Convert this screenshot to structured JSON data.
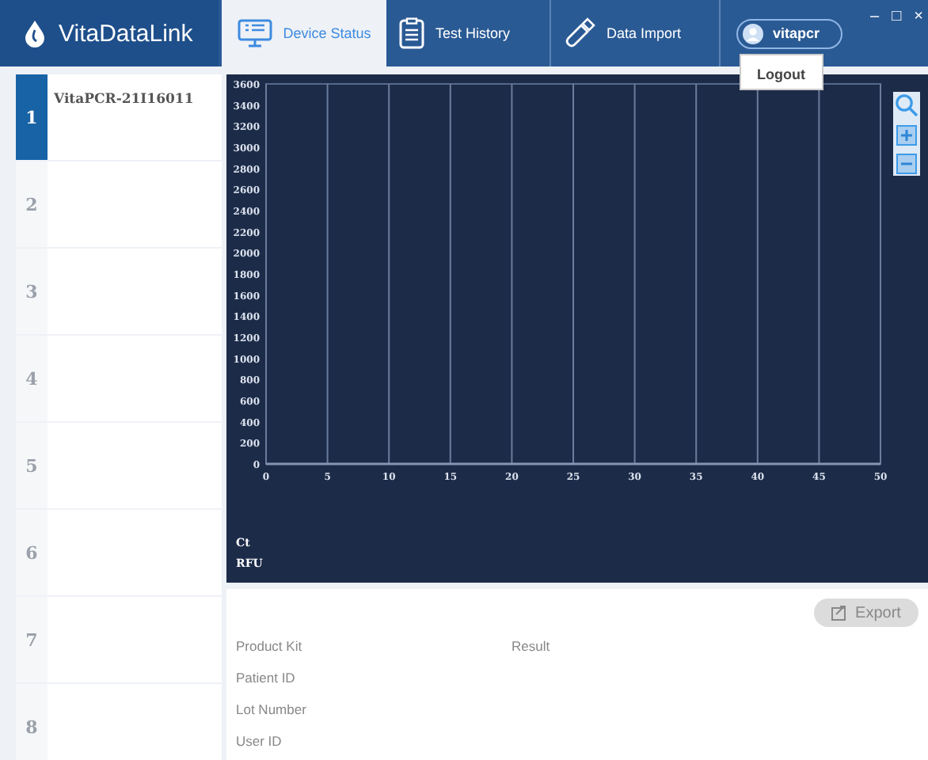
{
  "app": {
    "name": "VitaDataLink"
  },
  "tabs": [
    {
      "label": "Device Status",
      "selected": true
    },
    {
      "label": "Test History",
      "selected": false
    },
    {
      "label": "Data Import",
      "selected": false
    }
  ],
  "user": {
    "name": "vitapcr",
    "menu": [
      "Logout"
    ]
  },
  "window_controls": [
    "–",
    "□",
    "×"
  ],
  "slots": [
    {
      "number": "1",
      "device": "VitaPCR-21I16011",
      "selected": true
    },
    {
      "number": "2",
      "selected": false
    },
    {
      "number": "3",
      "selected": false
    },
    {
      "number": "4",
      "selected": false
    },
    {
      "number": "5",
      "selected": false
    },
    {
      "number": "6",
      "selected": false
    },
    {
      "number": "7",
      "selected": false
    },
    {
      "number": "8",
      "selected": false
    }
  ],
  "chart": {
    "labels": [
      "Ct",
      "RFU"
    ],
    "chart_data": {
      "type": "line",
      "grid": true,
      "xlim": [
        0,
        50
      ],
      "ylim": [
        0,
        3600
      ],
      "xticks": [
        0,
        5,
        10,
        15,
        20,
        25,
        30,
        35,
        40,
        45,
        50
      ],
      "yticks": [
        0,
        200,
        400,
        600,
        800,
        1000,
        1200,
        1400,
        1600,
        1800,
        2000,
        2200,
        2400,
        2600,
        2800,
        3000,
        3200,
        3400,
        3600
      ]
    }
  },
  "details": {
    "export": {
      "label": "Export",
      "disabled": true
    },
    "fields": [
      {
        "label": "Product Kit"
      },
      {
        "label": "Result"
      },
      {
        "label": "Patient ID"
      },
      {
        "label": "Lot Number"
      },
      {
        "label": "User ID"
      }
    ]
  }
}
